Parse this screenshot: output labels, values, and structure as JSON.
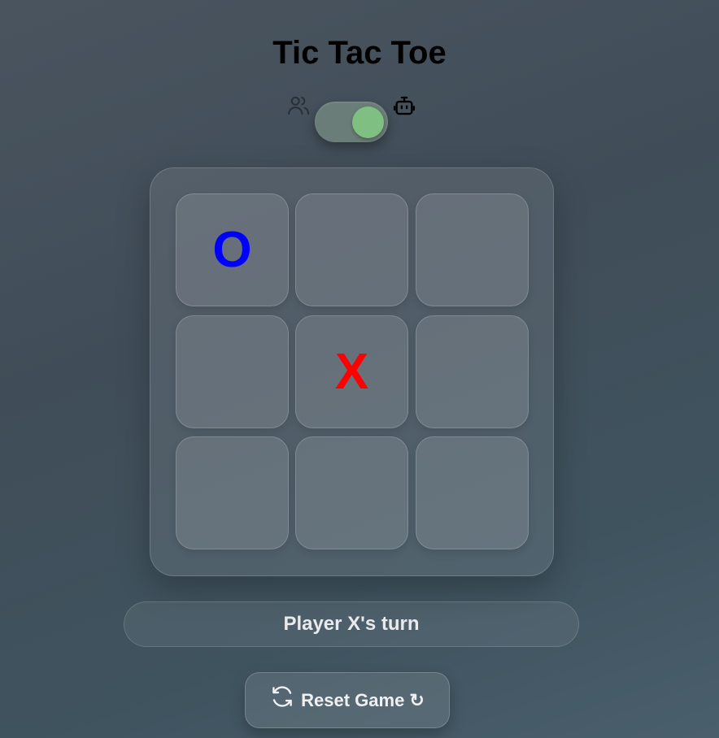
{
  "title": "Tic Tac Toe",
  "mode_toggle": {
    "left_icon": "users-icon",
    "right_icon": "bot-icon",
    "state": "on"
  },
  "board": {
    "cells": [
      "O",
      "",
      "",
      "",
      "X",
      "",
      "",
      "",
      ""
    ]
  },
  "status": "Player X's turn",
  "reset": {
    "label": "Reset Game ↻",
    "icon": "refresh-icon"
  },
  "colors": {
    "x_mark": "#ff0000",
    "o_mark": "#0000ff",
    "toggle_knob": "#7fbf82"
  }
}
